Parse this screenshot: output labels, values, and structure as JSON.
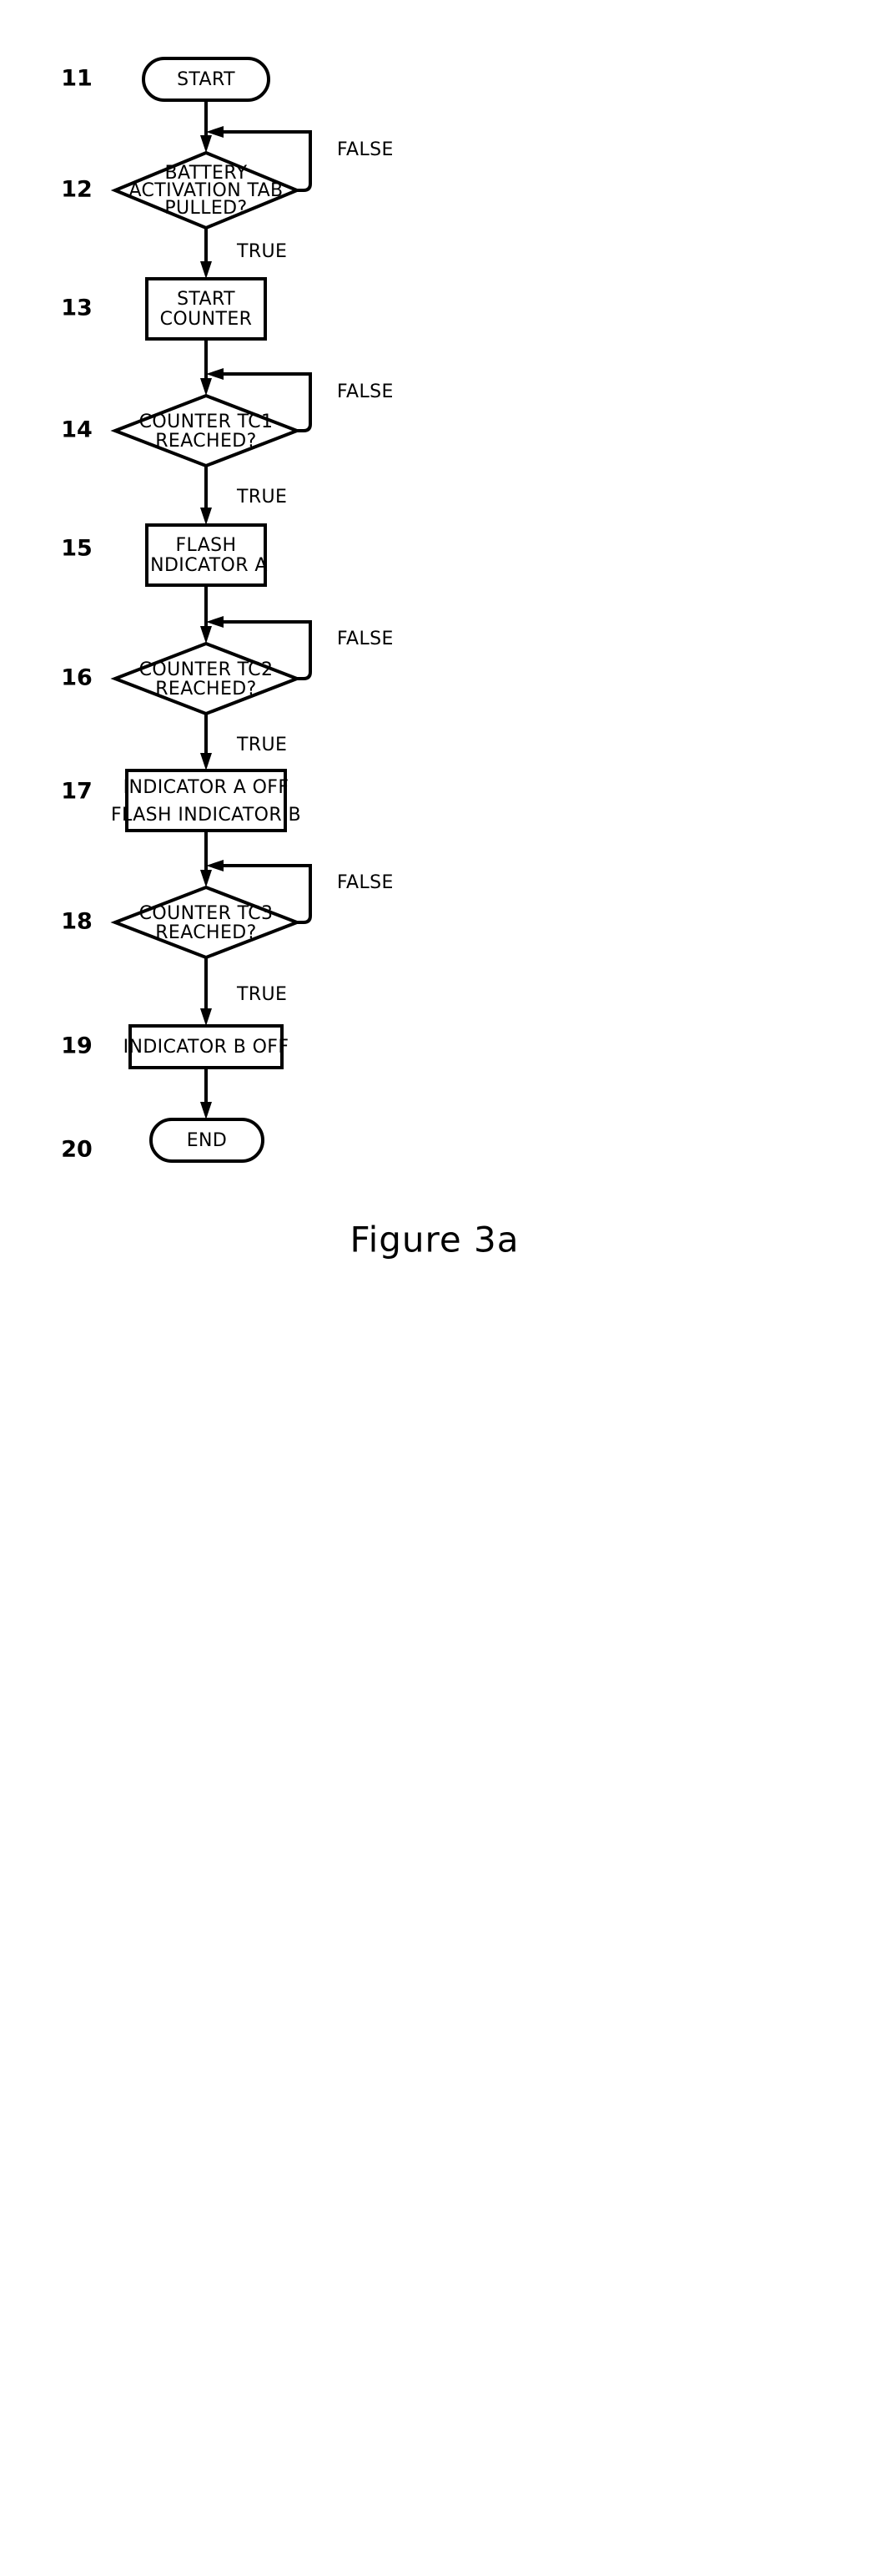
{
  "figure": {
    "caption": "Figure 3a"
  },
  "flowchart": {
    "type": "flowchart",
    "nodes": [
      {
        "ref": "11",
        "shape": "terminator",
        "lines": [
          "START"
        ]
      },
      {
        "ref": "12",
        "shape": "decision",
        "lines": [
          "BATTERY",
          "ACTIVATION TAB",
          "PULLED?"
        ],
        "true_label": "TRUE",
        "false_label": "FALSE"
      },
      {
        "ref": "13",
        "shape": "process",
        "lines": [
          "START",
          "COUNTER"
        ]
      },
      {
        "ref": "14",
        "shape": "decision",
        "lines": [
          "COUNTER TC1",
          "REACHED?"
        ],
        "true_label": "TRUE",
        "false_label": "FALSE"
      },
      {
        "ref": "15",
        "shape": "process",
        "lines": [
          "FLASH",
          "INDICATOR A"
        ]
      },
      {
        "ref": "16",
        "shape": "decision",
        "lines": [
          "COUNTER TC2",
          "REACHED?"
        ],
        "true_label": "TRUE",
        "false_label": "FALSE"
      },
      {
        "ref": "17",
        "shape": "process",
        "lines": [
          "INDICATOR A OFF",
          "FLASH INDICATOR B"
        ]
      },
      {
        "ref": "18",
        "shape": "decision",
        "lines": [
          "COUNTER TC3",
          "REACHED?"
        ],
        "true_label": "TRUE",
        "false_label": "FALSE"
      },
      {
        "ref": "19",
        "shape": "process",
        "lines": [
          "INDICATOR B OFF"
        ]
      },
      {
        "ref": "20",
        "shape": "terminator",
        "lines": [
          "END"
        ]
      }
    ]
  },
  "colors": {
    "stroke": "#000000",
    "fill": "#ffffff",
    "background": "#ffffff"
  }
}
